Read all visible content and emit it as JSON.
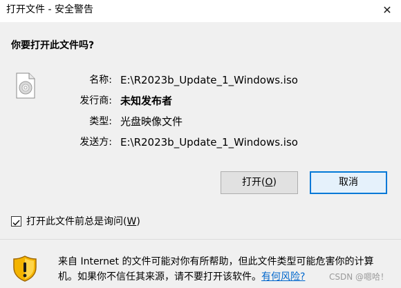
{
  "window": {
    "title": "打开文件 - 安全警告",
    "close_glyph": "✕"
  },
  "dialog": {
    "question": "你要打开此文件吗?",
    "file_icon": "disc-image-file-icon",
    "fields": [
      {
        "label": "名称:",
        "value": "E:\\R2023b_Update_1_Windows.iso"
      },
      {
        "label": "发行商:",
        "value": "未知发布者"
      },
      {
        "label": "类型:",
        "value": "光盘映像文件"
      },
      {
        "label": "发送方:",
        "value": "E:\\R2023b_Update_1_Windows.iso"
      }
    ],
    "buttons": {
      "open_label": "打开(",
      "open_mnemonic": "O",
      "open_suffix": ")",
      "cancel_label": "取消"
    },
    "checkbox": {
      "checked": true,
      "label": "打开此文件前总是询问(",
      "mnemonic": "W",
      "suffix": ")"
    }
  },
  "footer": {
    "warning_icon": "shield-warning-icon",
    "warning_text": "来自 Internet 的文件可能对你有所帮助，但此文件类型可能危害你的计算机。如果你不信任其来源，请不要打开该软件。",
    "risk_link": "有何风险?"
  },
  "watermark": "CSDN @嗯哈！",
  "colors": {
    "accent": "#0078d7",
    "link": "#0066cc",
    "background": "#f0f0f0"
  }
}
